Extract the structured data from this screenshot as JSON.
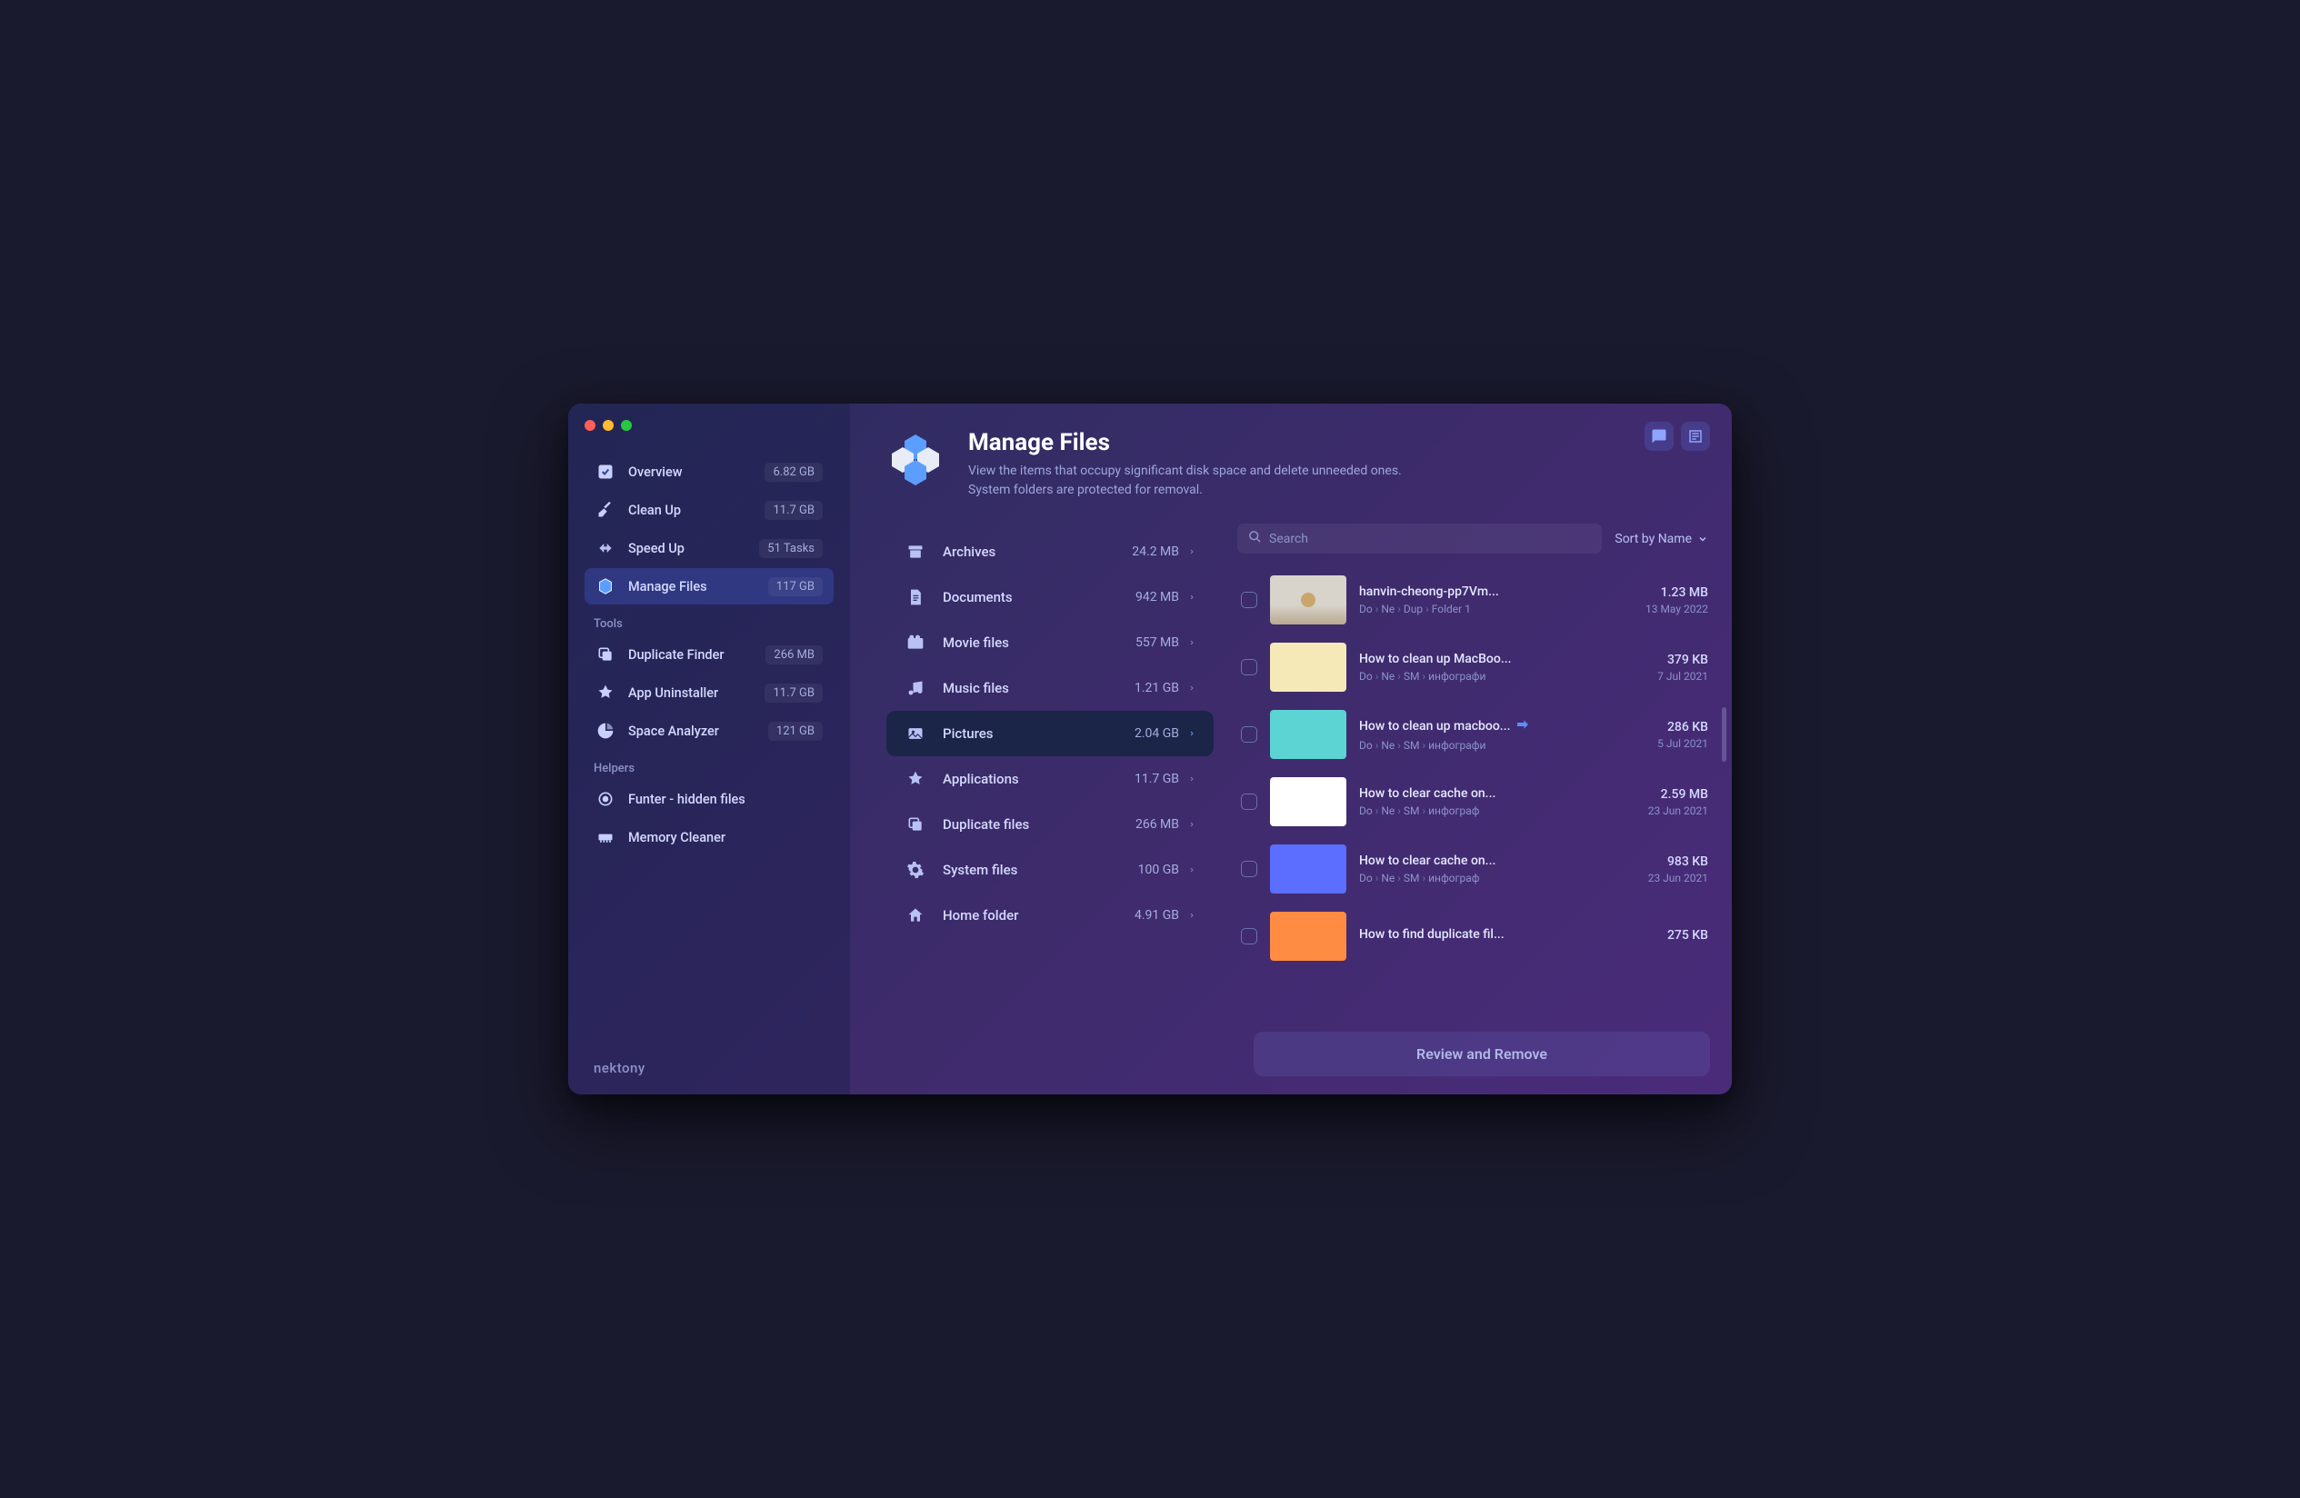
{
  "header": {
    "title": "Manage Files",
    "subtitle_line1": "View the items that occupy significant disk space and delete unneeded ones.",
    "subtitle_line2": "System folders are protected for removal."
  },
  "sidebar": {
    "main_items": [
      {
        "id": "overview",
        "label": "Overview",
        "value": "6.82 GB",
        "icon": "check-square"
      },
      {
        "id": "cleanup",
        "label": "Clean Up",
        "value": "11.7 GB",
        "icon": "broom"
      },
      {
        "id": "speedup",
        "label": "Speed Up",
        "value": "51 Tasks",
        "icon": "arrows"
      },
      {
        "id": "manage",
        "label": "Manage Files",
        "value": "117 GB",
        "icon": "hex",
        "active": true
      }
    ],
    "tools_label": "Tools",
    "tools_items": [
      {
        "id": "dup",
        "label": "Duplicate Finder",
        "value": "266 MB",
        "icon": "copy"
      },
      {
        "id": "uninst",
        "label": "App Uninstaller",
        "value": "11.7 GB",
        "icon": "app-x"
      },
      {
        "id": "space",
        "label": "Space Analyzer",
        "value": "121 GB",
        "icon": "pie"
      }
    ],
    "helpers_label": "Helpers",
    "helpers_items": [
      {
        "id": "funter",
        "label": "Funter - hidden files",
        "icon": "target"
      },
      {
        "id": "memclean",
        "label": "Memory Cleaner",
        "icon": "ram"
      }
    ]
  },
  "brand": "nektony",
  "categories": [
    {
      "id": "archives",
      "label": "Archives",
      "size": "24.2 MB",
      "icon": "archive"
    },
    {
      "id": "documents",
      "label": "Documents",
      "size": "942 MB",
      "icon": "doc"
    },
    {
      "id": "movies",
      "label": "Movie files",
      "size": "557 MB",
      "icon": "movie"
    },
    {
      "id": "music",
      "label": "Music files",
      "size": "1.21 GB",
      "icon": "music"
    },
    {
      "id": "pictures",
      "label": "Pictures",
      "size": "2.04 GB",
      "icon": "picture",
      "selected": true
    },
    {
      "id": "apps",
      "label": "Applications",
      "size": "11.7 GB",
      "icon": "app"
    },
    {
      "id": "dupfiles",
      "label": "Duplicate files",
      "size": "266 MB",
      "icon": "dup"
    },
    {
      "id": "system",
      "label": "System files",
      "size": "100 GB",
      "icon": "gear"
    },
    {
      "id": "home",
      "label": "Home folder",
      "size": "4.91 GB",
      "icon": "home"
    }
  ],
  "files_panel": {
    "search_placeholder": "Search",
    "sort_label": "Sort by Name",
    "review_button": "Review and Remove"
  },
  "files": [
    {
      "name": "hanvin-cheong-pp7Vm...",
      "path": [
        "Do",
        "Ne",
        "Dup",
        "Folder 1"
      ],
      "size": "1.23 MB",
      "date": "13 May 2022",
      "thumb": "desk"
    },
    {
      "name": "How to clean up MacBoo...",
      "path": [
        "Do",
        "Ne",
        "SM",
        "инфографи"
      ],
      "size": "379 KB",
      "date": "7 Jul 2021",
      "thumb": "info1"
    },
    {
      "name": "How to clean up macboo...",
      "path": [
        "Do",
        "Ne",
        "SM",
        "инфографи"
      ],
      "size": "286 KB",
      "date": "5 Jul 2021",
      "thumb": "info2",
      "alias": true
    },
    {
      "name": "How to clear cache on...",
      "path": [
        "Do",
        "Ne",
        "SM",
        "инфограф"
      ],
      "size": "2.59 MB",
      "date": "23 Jun 2021",
      "thumb": "info3"
    },
    {
      "name": "How to clear cache on...",
      "path": [
        "Do",
        "Ne",
        "SM",
        "инфограф"
      ],
      "size": "983 KB",
      "date": "23 Jun 2021",
      "thumb": "info4"
    },
    {
      "name": "How to find duplicate fil...",
      "path": [],
      "size": "275 KB",
      "date": "",
      "thumb": "info5"
    }
  ]
}
